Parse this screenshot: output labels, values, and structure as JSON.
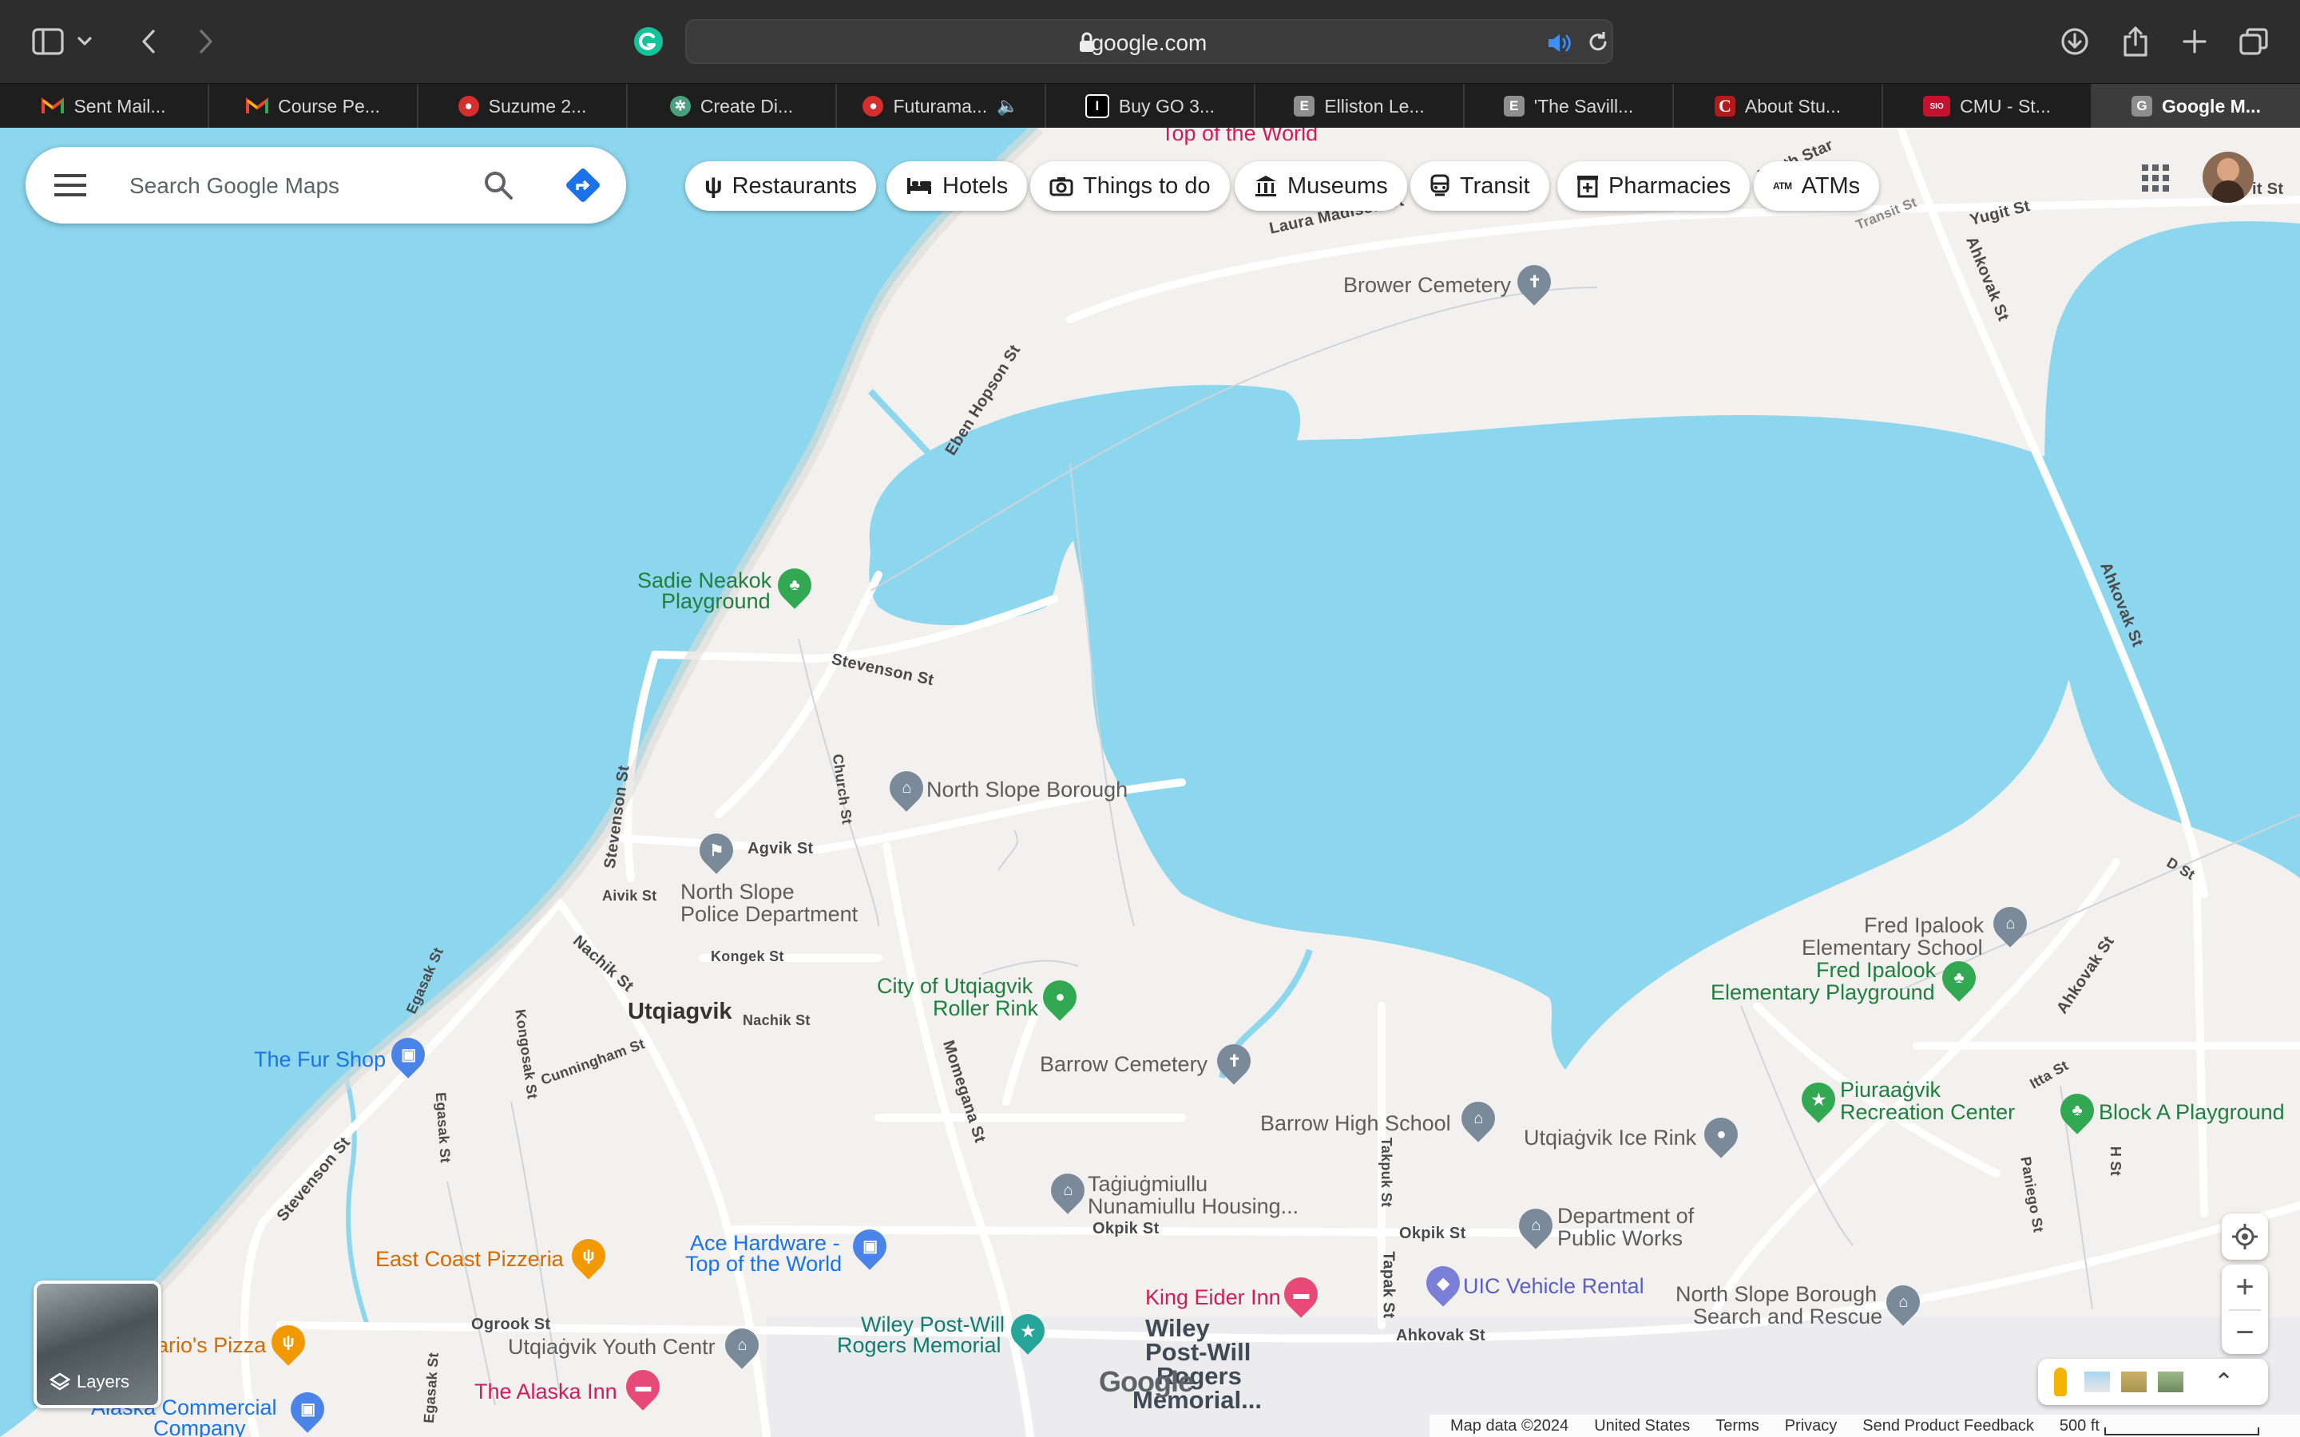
{
  "browser": {
    "url": "google.com",
    "tabs": [
      {
        "label": "Sent Mail...",
        "favicon": "gmail-icon",
        "color": "#ea4335"
      },
      {
        "label": "Course Pe...",
        "favicon": "gmail-icon",
        "color": "#ea4335"
      },
      {
        "label": "Suzume 2...",
        "favicon": "movie-icon",
        "color": "#d32f2f"
      },
      {
        "label": "Create Di...",
        "favicon": "chatgpt-icon",
        "color": "#4aa181"
      },
      {
        "label": "Futurama...",
        "favicon": "movie-icon",
        "color": "#d32f2f",
        "audio": true
      },
      {
        "label": "Buy GO 3...",
        "favicon": "store-icon",
        "color": "#000000"
      },
      {
        "label": "Elliston Le...",
        "favicon": "letter-e-icon",
        "color": "#8e8e8e"
      },
      {
        "label": "'The Savill...",
        "favicon": "letter-e-icon",
        "color": "#8e8e8e"
      },
      {
        "label": "About Stu...",
        "favicon": "letter-c-icon",
        "color": "#b31b1b"
      },
      {
        "label": "CMU - St...",
        "favicon": "sio-icon",
        "color": "#c41230"
      },
      {
        "label": "Google M...",
        "favicon": "letter-g-icon",
        "color": "#8e8e8e",
        "active": true
      }
    ],
    "tab_letters": {
      "i": "I",
      "e1": "E",
      "e2": "E",
      "c": "C",
      "sio": "SIO",
      "g": "G"
    }
  },
  "search": {
    "placeholder": "Search Google Maps"
  },
  "chips": [
    {
      "label": "Restaurants",
      "icon": "fork-knife-icon"
    },
    {
      "label": "Hotels",
      "icon": "bed-icon"
    },
    {
      "label": "Things to do",
      "icon": "camera-icon"
    },
    {
      "label": "Museums",
      "icon": "museum-icon"
    },
    {
      "label": "Transit",
      "icon": "train-icon"
    },
    {
      "label": "Pharmacies",
      "icon": "pharmacy-icon"
    },
    {
      "label": "ATMs",
      "icon": "atm-icon"
    }
  ],
  "atm_text": "ATM",
  "map": {
    "places": {
      "top_world_upper": "Top of the World",
      "brower_cemetery": "Brower Cemetery",
      "sadie_neakok_1": "Sadie Neakok",
      "sadie_neakok_2": "Playground",
      "north_slope_borough": "North Slope Borough",
      "north_slope_police_1": "North Slope",
      "north_slope_police_2": "Police Department",
      "city_roller_1": "City of Utqiagvik",
      "city_roller_2": "Roller Rink",
      "utqiagvik": "Utqiagvik",
      "fur_shop": "The Fur Shop",
      "barrow_cemetery": "Barrow Cemetery",
      "barrow_high": "Barrow High School",
      "ice_rink": "Utqiaġvik Ice Rink",
      "fred_elem_1": "Fred Ipalook",
      "fred_elem_2": "Elementary School",
      "fred_play_1": "Fred Ipalook",
      "fred_play_2": "Elementary Playground",
      "piuraagvik_1": "Piuraaġvik",
      "piuraagvik_2": "Recreation Center",
      "block_a": "Block A Playground",
      "tagiu_1": "Taġiuġmiullu",
      "tagiu_2": "Nunamiullu Housing...",
      "dpw_1": "Department of",
      "dpw_2": "Public Works",
      "east_coast": "East Coast Pizzeria",
      "ace_1": "Ace Hardware -",
      "ace_2": "Top of the World",
      "king_eider": "King Eider Inn",
      "uic_vehicle": "UIC Vehicle Rental",
      "nsb_search_1": "North Slope Borough",
      "nsb_search_2": "Search and Rescue",
      "marios": "ario's Pizza",
      "wiley_1": "Wiley Post-Will",
      "wiley_2": "Rogers Memorial",
      "youth_centr": "Utqiaġvik Youth Centr",
      "wiley_big_1": "Wiley",
      "wiley_big_2": "Post-Will",
      "wiley_big_3": "Rogers",
      "wiley_big_4": "Memorial...",
      "alaska_inn": "The Alaska Inn",
      "alaska_comm_1": "Alaska Commercial",
      "alaska_comm_2": "Company"
    },
    "streets": {
      "north_star": "North Star",
      "transit": "Transit St",
      "yugit": "Yugit St",
      "it_st": "it St",
      "ahkovak_top": "Ahkovak St",
      "laura_madison": "Laura Madison St",
      "eben_hopson": "Eben Hopson St",
      "ahkovak_right": "Ahkovak St",
      "stevenson_mid": "Stevenson St",
      "stevenson_left": "Stevenson St",
      "church": "Church St",
      "agvik": "Agvik St",
      "aivik": "Aivik St",
      "kongek": "Kongek St",
      "nachik_diag": "Nachik St",
      "nachik": "Nachik St",
      "egasak_top": "Egasak St",
      "kongosak": "Kongosak St",
      "cunningham": "Cunningham St",
      "egasak_mid": "Egasak St",
      "momegana": "Momegana St",
      "stevenson_bottom": "Stevenson St",
      "okpik_mid": "Okpik St",
      "okpik_right": "Okpik St",
      "takpuk": "Takpuk St",
      "tapak": "Tapak St",
      "ahkovak_bottom": "Ahkovak St",
      "ogrook": "Ogrook St",
      "egasak_bottom": "Egasak St",
      "d_st": "D St",
      "ahkovak_lower": "Ahkovak St",
      "itta": "Itta St",
      "paniego": "Paniego St",
      "h_st": "H St"
    },
    "layers_label": "Layers",
    "google_logo": "Google",
    "footer": {
      "map_data": "Map data ©2024",
      "country": "United States",
      "terms": "Terms",
      "privacy": "Privacy",
      "feedback": "Send Product Feedback",
      "scale": "500 ft"
    },
    "colors": {
      "water": "#8dd7ee",
      "land": "#f2f1ef",
      "road": "#ffffff",
      "road_edge": "#cfd4da"
    }
  }
}
